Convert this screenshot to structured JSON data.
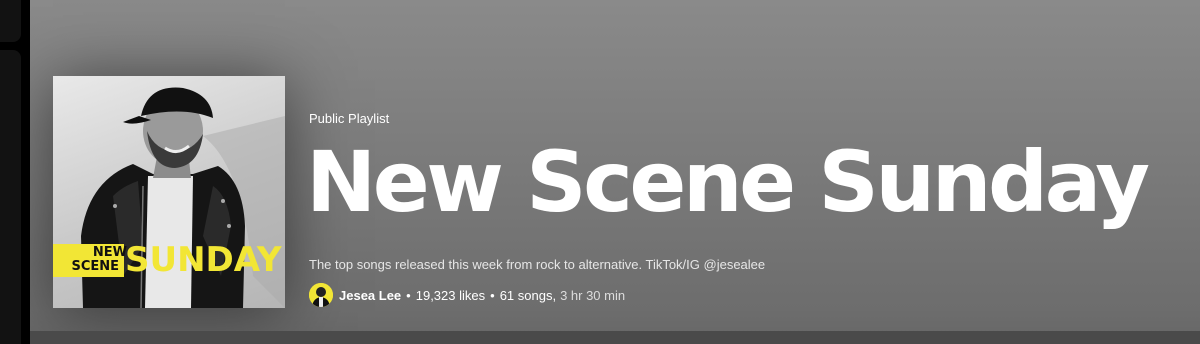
{
  "playlist": {
    "type_label": "Public Playlist",
    "title": "New Scene Sunday",
    "description": "The top songs released this week from rock to alternative. TikTok/IG @jesealee",
    "owner": "Jesea Lee",
    "likes": "19,323 likes",
    "songs": "61 songs,",
    "duration": "3 hr 30 min",
    "separator": "•"
  },
  "cover": {
    "line1": "NEW",
    "line2": "SCENE",
    "line3": "SUNDAY",
    "accent_color": "#f2e635"
  }
}
